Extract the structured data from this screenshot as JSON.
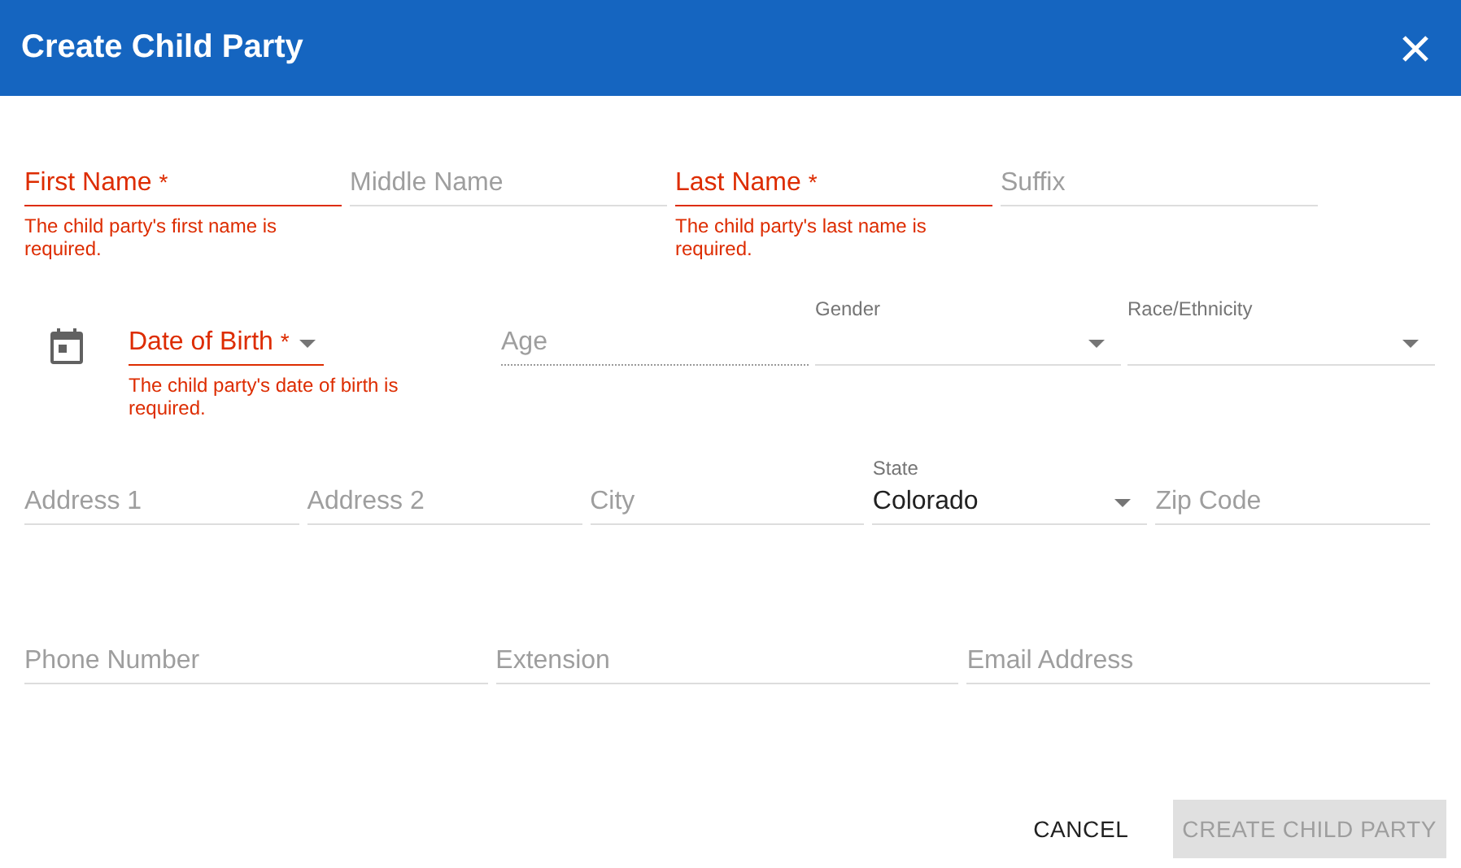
{
  "dialog": {
    "title": "Create Child Party"
  },
  "rows": [
    {
      "kind": "names",
      "fields": [
        {
          "kind": "text",
          "label": "First Name",
          "required_mark": "*",
          "floated": false,
          "disabled": false,
          "error": "The child party's first name is required."
        },
        {
          "kind": "text",
          "label": "Middle Name",
          "floated": false,
          "disabled": false
        },
        {
          "kind": "text",
          "label": "Last Name",
          "required_mark": "*",
          "floated": false,
          "disabled": false,
          "error": "The child party's last name is required."
        },
        {
          "kind": "text",
          "label": "Suffix",
          "floated": false,
          "disabled": false
        }
      ]
    },
    {
      "kind": "birth",
      "fields": [
        {
          "kind": "date-select",
          "label": "Date of Birth",
          "required_mark": "*",
          "floated": false,
          "disabled": false,
          "error": "The child party's date of birth is required."
        },
        {
          "kind": "text",
          "label": "Age",
          "floated": false,
          "disabled": true
        },
        {
          "kind": "select",
          "label": "Gender",
          "floated": true,
          "disabled": false
        },
        {
          "kind": "select",
          "label": "Race/Ethnicity",
          "floated": true,
          "disabled": false
        }
      ]
    },
    {
      "kind": "address",
      "fields": [
        {
          "kind": "text",
          "label": "Address 1",
          "floated": false,
          "disabled": false
        },
        {
          "kind": "text",
          "label": "Address 2",
          "floated": false,
          "disabled": false
        },
        {
          "kind": "text",
          "label": "City",
          "floated": false,
          "disabled": false
        },
        {
          "kind": "select",
          "label": "State",
          "value": "Colorado",
          "floated": true,
          "disabled": false
        },
        {
          "kind": "text",
          "label": "Zip Code",
          "floated": false,
          "disabled": false
        }
      ]
    },
    {
      "kind": "contact",
      "fields": [
        {
          "kind": "text",
          "label": "Phone Number",
          "floated": false,
          "disabled": false
        },
        {
          "kind": "text",
          "label": "Extension",
          "floated": false,
          "disabled": false
        },
        {
          "kind": "text",
          "label": "Email Address",
          "floated": false,
          "disabled": false
        }
      ]
    }
  ],
  "buttons": [
    {
      "label": "CANCEL",
      "disabled": false
    },
    {
      "label": "CREATE CHILD PARTY",
      "disabled": true
    }
  ]
}
